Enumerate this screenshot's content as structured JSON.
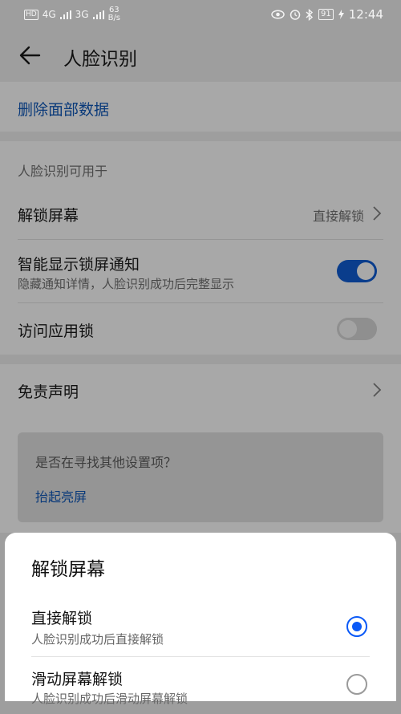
{
  "status_bar": {
    "hd": "HD",
    "net1": "4G",
    "net2": "3G",
    "speed_value": "63",
    "speed_unit": "B/s",
    "battery": "91",
    "time": "12:44"
  },
  "header": {
    "title": "人脸识别"
  },
  "delete_section": {
    "label": "删除面部数据"
  },
  "usage": {
    "group_label": "人脸识别可用于",
    "unlock": {
      "title": "解锁屏幕",
      "value": "直接解锁"
    },
    "smart_notify": {
      "title": "智能显示锁屏通知",
      "subtitle": "隐藏通知详情，人脸识别成功后完整显示",
      "enabled": true
    },
    "app_lock": {
      "title": "访问应用锁",
      "enabled": false
    }
  },
  "disclaimer": {
    "title": "免责声明"
  },
  "suggest": {
    "question": "是否在寻找其他设置项？",
    "link": "抬起亮屏"
  },
  "sheet": {
    "title": "解锁屏幕",
    "options": [
      {
        "title": "直接解锁",
        "subtitle": "人脸识别成功后直接解锁",
        "selected": true
      },
      {
        "title": "滑动屏幕解锁",
        "subtitle": "人脸识别成功后滑动屏幕解锁",
        "selected": false
      }
    ]
  },
  "colors": {
    "accent": "#0a59f7",
    "link": "#0a3a7a",
    "overlay_bg": "#9e9e9e"
  }
}
